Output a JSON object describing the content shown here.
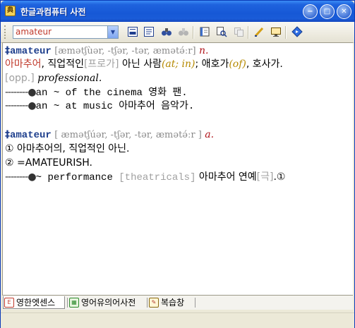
{
  "window": {
    "title": "한글과컴퓨터 사전",
    "app_icon_glyph": "典",
    "controls": {
      "minimize": "−",
      "maximize": "□",
      "close": "✕"
    }
  },
  "toolbar": {
    "search": {
      "value": "amateur",
      "placeholder": ""
    },
    "buttons": [
      "dictionary-view-icon",
      "word-list-icon",
      "binoculars-icon",
      "binoculars-disabled-icon",
      "notebook-icon",
      "multi-search-icon",
      "copy-icon",
      "highlighter-icon",
      "monitor-capture-icon",
      "help-diamond-icon"
    ]
  },
  "colors": {
    "titlebar": "#1658d6",
    "headword": "#1d3e8c",
    "korean_red": "#c0392b",
    "pos": "#b0151b",
    "gray": "#a0a0a0",
    "olive": "#b58900"
  },
  "entry1": {
    "dagger": "‡",
    "headword": "amateur",
    "pronunciation": "[æmətʃùər, ‐tʃər, ‐tər, æmətə́ːr]",
    "pos": "n.",
    "def_red": "아마추어",
    "def_1": ", 직업적인",
    "def_gray": "[프로가]",
    "def_2": " 아닌 사람",
    "def_olive": "(at; in)",
    "def_3": "; 애호가",
    "def_olive2": "(of)",
    "def_4": ", 호사가.",
    "opp_label": "[opp.]",
    "opp_word": "professional.",
    "ex1_dots": "--------●",
    "ex1": "an ~ of the cinema 영화 팬.",
    "ex2_dots": "--------●",
    "ex2": "an ~ at music 아마추어 음악가."
  },
  "entry2": {
    "dagger": "‡",
    "headword": "amateur",
    "pronunciation": "[ æmətʃúər, ‐tʃər, ‐tər, æmətə́ːr ]",
    "pos": "a.",
    "sense1": "① 아마추어의, 직업적인 아닌.",
    "sense2": "② =AMATEURISH.",
    "ex1_dots": "--------●",
    "ex1_a": "~ performance ",
    "ex1_gray": "[theatricals]",
    "ex1_b": " 아마추어 연예",
    "ex1_gray2": "[극]",
    "ex1_c": ".①"
  },
  "tabs": [
    {
      "label": "영한엣센스",
      "icon": "essence-dict-icon"
    },
    {
      "label": "영어유의어사전",
      "icon": "thesaurus-icon"
    },
    {
      "label": "복습창",
      "icon": "review-notebook-icon"
    }
  ]
}
